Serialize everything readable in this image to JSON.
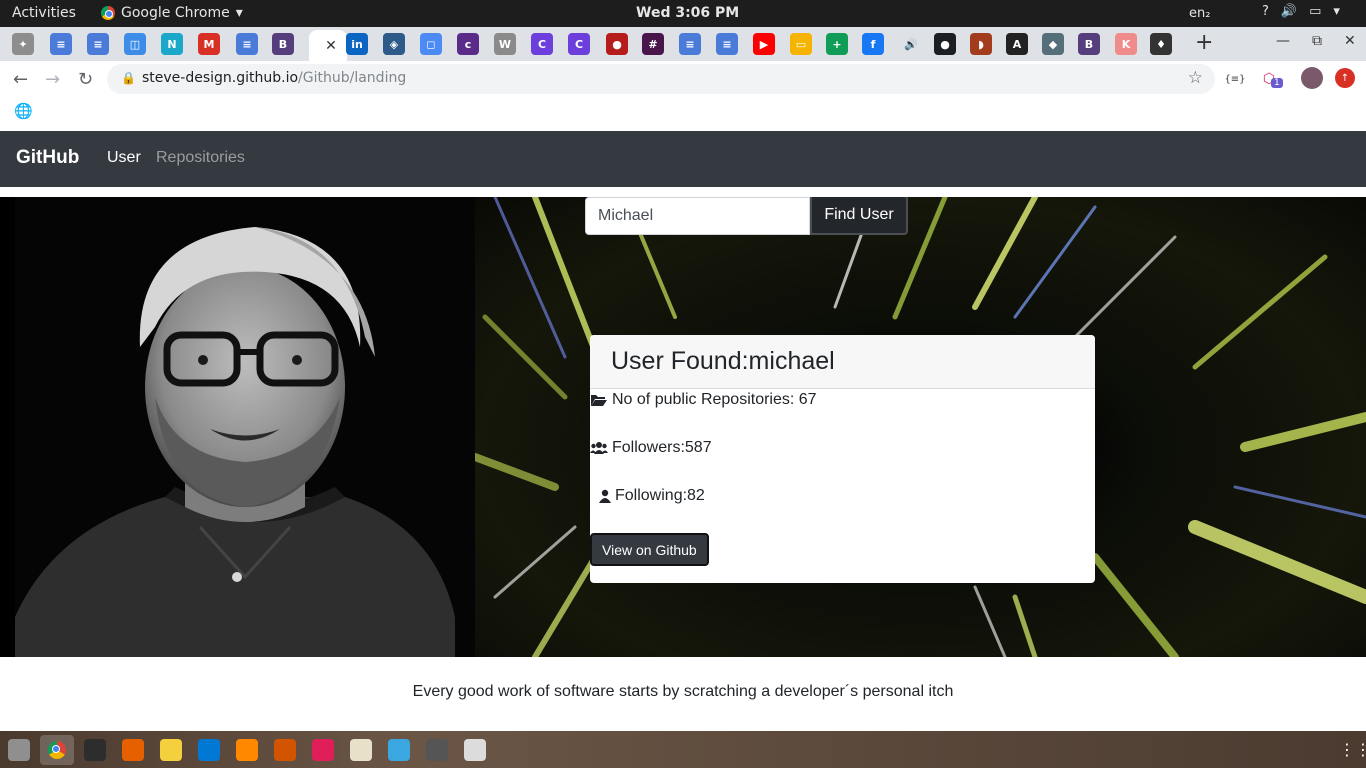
{
  "system_bar": {
    "activities": "Activities",
    "app_name": "Google Chrome",
    "app_menu_arrow": "▾",
    "clock": "Wed  3:06 PM",
    "language": "en₂",
    "tray_help": "?",
    "tray_volume": "🔊",
    "tray_menu": "▾"
  },
  "tabs": [
    {
      "icon": "gitbook-icon",
      "color": "#8d8d8d",
      "glyph": "✦"
    },
    {
      "icon": "docs-icon",
      "color": "#4a7bd8",
      "glyph": "≡"
    },
    {
      "icon": "docs-icon",
      "color": "#4a7bd8",
      "glyph": "≡"
    },
    {
      "icon": "square-icon",
      "color": "#3d8de8",
      "glyph": "◫"
    },
    {
      "icon": "n-icon",
      "color": "#1aa7c9",
      "glyph": "N"
    },
    {
      "icon": "gmail-icon",
      "color": "#d93025",
      "glyph": "M"
    },
    {
      "icon": "docs-icon",
      "color": "#4a7bd8",
      "glyph": "≡"
    },
    {
      "icon": "bootstrap-icon",
      "color": "#563d7c",
      "glyph": "B"
    },
    {
      "icon": "active-tab",
      "color": "#ffffff",
      "glyph": "✕"
    },
    {
      "icon": "linkedin-icon",
      "color": "#0a66c2",
      "glyph": "in"
    },
    {
      "icon": "box-icon",
      "color": "#2e5a8a",
      "glyph": "◈"
    },
    {
      "icon": "frame-icon",
      "color": "#4c8bf5",
      "glyph": "◻"
    },
    {
      "icon": "colorlib-icon",
      "color": "#5b2b8a",
      "glyph": "c"
    },
    {
      "icon": "wordpress-icon",
      "color": "#8a8a8a",
      "glyph": "W"
    },
    {
      "icon": "canva-icon",
      "color": "#6c3fdc",
      "glyph": "C"
    },
    {
      "icon": "canva-icon",
      "color": "#6c3fdc",
      "glyph": "C"
    },
    {
      "icon": "dot-icon",
      "color": "#b71c1c",
      "glyph": "●"
    },
    {
      "icon": "slack-icon",
      "color": "#4a154b",
      "glyph": "#"
    },
    {
      "icon": "docs-icon",
      "color": "#4a7bd8",
      "glyph": "≡"
    },
    {
      "icon": "docs-icon",
      "color": "#4a7bd8",
      "glyph": "≡"
    },
    {
      "icon": "youtube-icon",
      "color": "#ff0000",
      "glyph": "▶"
    },
    {
      "icon": "slides-icon",
      "color": "#f4b400",
      "glyph": "▭"
    },
    {
      "icon": "sheets-plus-icon",
      "color": "#0f9d58",
      "glyph": "+"
    },
    {
      "icon": "facebook-icon",
      "color": "#1877f2",
      "glyph": "f"
    },
    {
      "icon": "audio-icon",
      "color": "#dee1e6",
      "glyph": "🔊"
    },
    {
      "icon": "github-icon",
      "color": "#1b1f23",
      "glyph": "●"
    },
    {
      "icon": "firebase-icon",
      "color": "#a33b1d",
      "glyph": "◗"
    },
    {
      "icon": "angular-icon",
      "color": "#222222",
      "glyph": "A"
    },
    {
      "icon": "layers-icon",
      "color": "#546e7a",
      "glyph": "◆"
    },
    {
      "icon": "bootstrap-icon",
      "color": "#563d7c",
      "glyph": "B"
    },
    {
      "icon": "k-icon",
      "color": "#f08b8b",
      "glyph": "K"
    },
    {
      "icon": "flame-icon",
      "color": "#333333",
      "glyph": "♦"
    }
  ],
  "tabstrip": {
    "new_tab": "+",
    "minimize": "—",
    "maximize": "⧉",
    "close": "✕"
  },
  "address_bar": {
    "back": "←",
    "forward": "→",
    "reload": "↻",
    "url_host": "steve-design.github.io",
    "url_path": "/Github/landing",
    "star": "☆",
    "ext_badge": "1"
  },
  "bookmark_bar": {
    "globe": "🌐"
  },
  "navbar": {
    "brand": "GitHub",
    "user": "User",
    "repositories": "Repositories"
  },
  "search": {
    "value": "Michael",
    "button": "Find User"
  },
  "card": {
    "title": "User Found:michael",
    "repos": "No of public Repositories: 67",
    "followers": "Followers:587",
    "following": "Following:82",
    "view_button": "View on Github"
  },
  "footer": {
    "tagline": "Every good work of software starts by scratching a developer´s personal itch"
  },
  "dock": {
    "grid_glyph": "⋮⋮⋮",
    "apps": [
      {
        "name": "files-icon",
        "color": "#8f8f8f"
      },
      {
        "name": "chrome-icon",
        "color": "#4285f4"
      },
      {
        "name": "terminal-icon",
        "color": "#2d2d2d"
      },
      {
        "name": "firefox-icon",
        "color": "#e66000"
      },
      {
        "name": "notes-icon",
        "color": "#f4d03f"
      },
      {
        "name": "vscode-icon",
        "color": "#0078d4"
      },
      {
        "name": "vlc-icon",
        "color": "#ff8800"
      },
      {
        "name": "office-icon",
        "color": "#d35400"
      },
      {
        "name": "slack-icon",
        "color": "#e01e5a"
      },
      {
        "name": "document-icon",
        "color": "#e8e0c8"
      },
      {
        "name": "sparkle-icon",
        "color": "#3aa7e0"
      },
      {
        "name": "system-icon",
        "color": "#555555"
      },
      {
        "name": "editor-icon",
        "color": "#dcdcdc"
      }
    ]
  }
}
